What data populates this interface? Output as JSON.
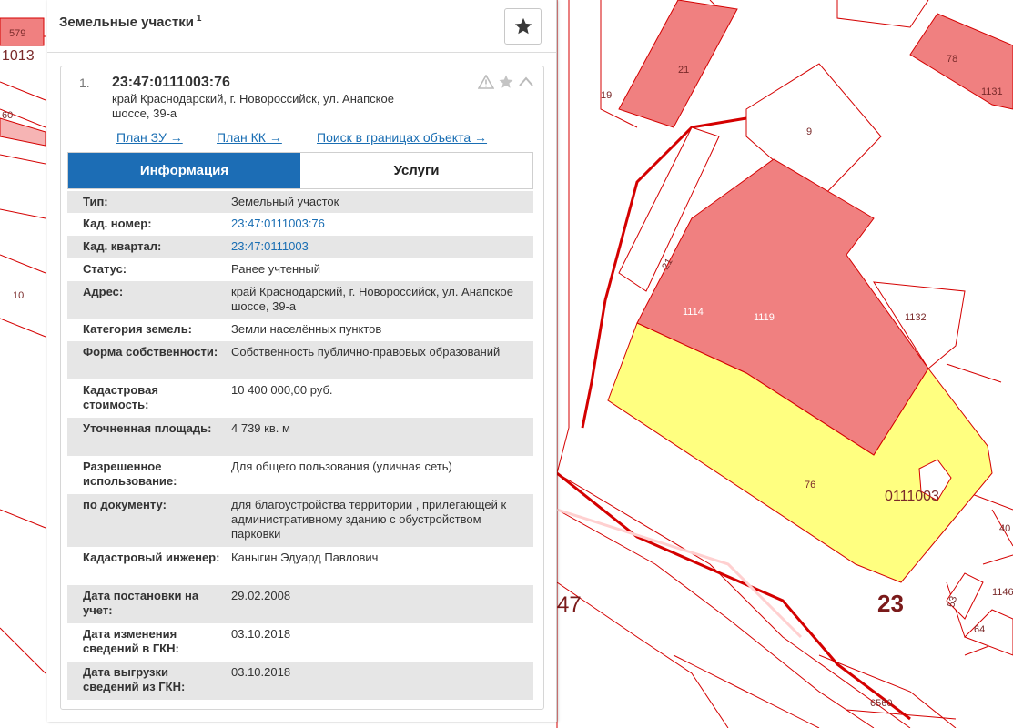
{
  "panel": {
    "title": "Земельные участки",
    "title_count": "1",
    "favorite_icon": "star-icon"
  },
  "card": {
    "number": "1.",
    "cadastral_number": "23:47:0111003:76",
    "address": "край Краснодарский, г. Новороссийск, ул. Анапское шоссе, 39-а",
    "icons": [
      "warning-icon",
      "star-icon",
      "chevron-up-icon"
    ],
    "links": {
      "plan_zu": "План ЗУ →",
      "plan_kk": "План КК →",
      "search": "Поиск в границах объекта →"
    },
    "tabs": {
      "info": "Информация",
      "services": "Услуги"
    },
    "rows": [
      {
        "label": "Тип:",
        "value": "Земельный участок"
      },
      {
        "label": "Кад. номер:",
        "value": "23:47:0111003:76"
      },
      {
        "label": "Кад. квартал:",
        "value": "23:47:0111003"
      },
      {
        "label": "Статус:",
        "value": "Ранее учтенный"
      },
      {
        "label": "Адрес:",
        "value": "край Краснодарский, г. Новороссийск, ул. Анапское шоссе, 39-а"
      },
      {
        "label": "Категория земель:",
        "value": "Земли населённых пунктов"
      },
      {
        "label": "Форма собственности:",
        "value": "Собственность публично-правовых образований"
      },
      {
        "label": "Кадастровая стоимость:",
        "value": "10 400 000,00 руб."
      },
      {
        "label": "Уточненная площадь:",
        "value": "4 739 кв. м"
      },
      {
        "label": "Разрешенное использование:",
        "value": "Для общего пользования (уличная сеть)"
      },
      {
        "label": "по документу:",
        "value": "для благоустройства территории , прилегающей к административному зданию с обустройством парковки"
      },
      {
        "label": "Кадастровый инженер:",
        "value": "Каныгин Эдуард Павлович"
      },
      {
        "label": "Дата постановки на учет:",
        "value": "29.02.2008"
      },
      {
        "label": "Дата изменения сведений в ГКН:",
        "value": "03.10.2018"
      },
      {
        "label": "Дата выгрузки сведений из ГКН:",
        "value": "03.10.2018"
      }
    ]
  },
  "map": {
    "labels": {
      "l579": "579",
      "l1013": "1013",
      "l60": "60",
      "l10": "10",
      "l21a": "21",
      "l19": "19",
      "l78": "78",
      "l1131": "1131",
      "l9": "9",
      "l21b": "21",
      "l1114": "1114",
      "l1119": "1119",
      "l1132": "1132",
      "l76": "76",
      "l0111003": "0111003",
      "l23": "23",
      "l47": "47",
      "l53": "53",
      "l64": "64",
      "l1146": "1146",
      "l6560": "6560",
      "l40": "40"
    },
    "colors": {
      "parcel_red": "#f08080",
      "parcel_yellow": "#ffff80",
      "outline": "#d40000"
    }
  }
}
